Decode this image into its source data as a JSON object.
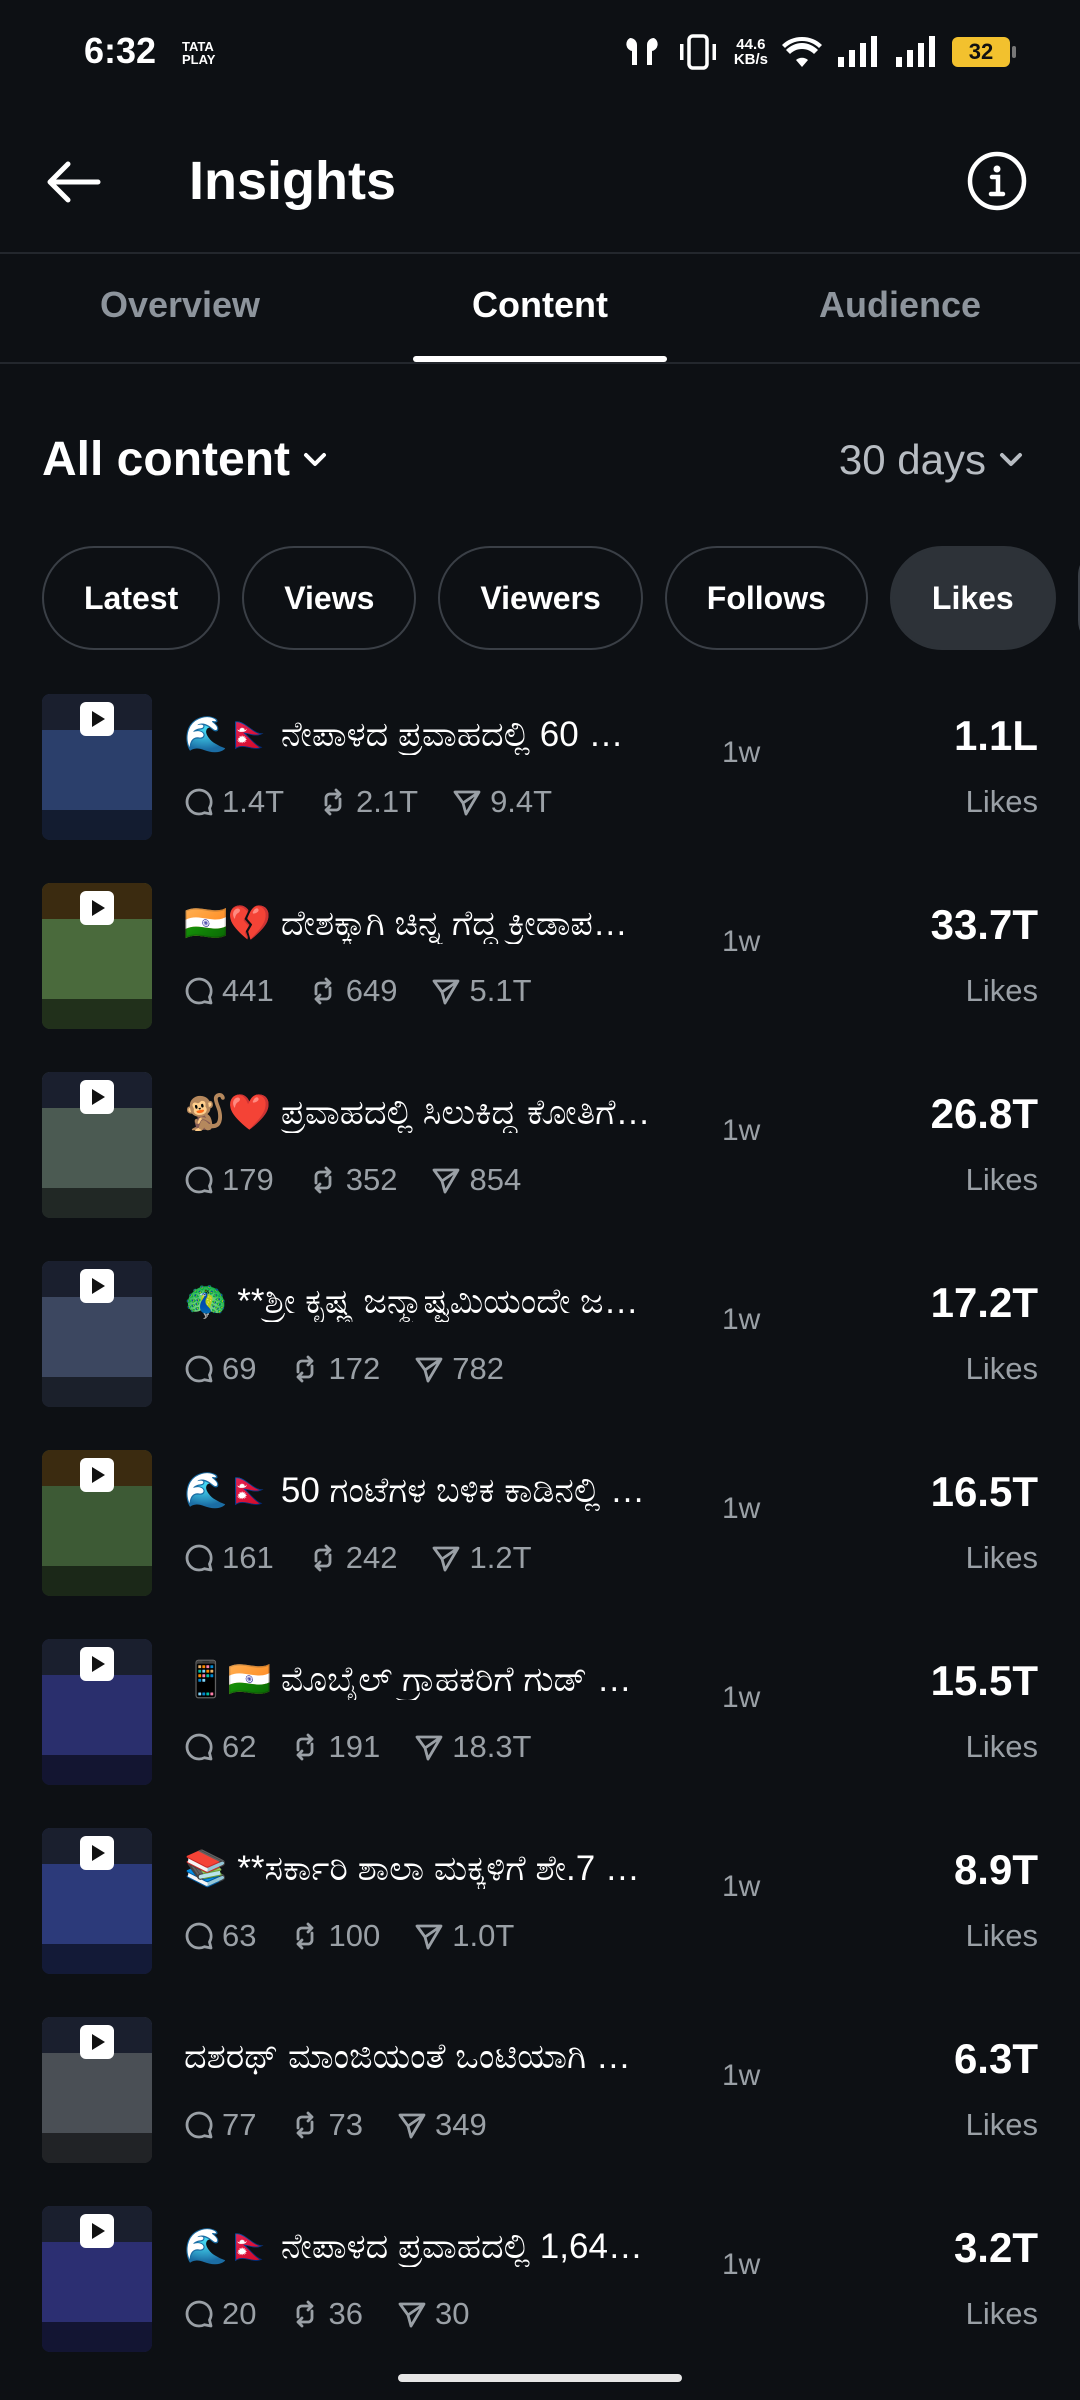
{
  "status": {
    "time": "6:32",
    "carrier": "TATA\nPLAY",
    "speed": "44.6\nKB/s",
    "battery": "32"
  },
  "header": {
    "title": "Insights"
  },
  "tabs": [
    "Overview",
    "Content",
    "Audience"
  ],
  "active_tab": "Content",
  "content_filter": "All content",
  "range": "30 days",
  "chips": [
    "Latest",
    "Views",
    "Viewers",
    "Follows",
    "Likes"
  ],
  "active_chip": "Likes",
  "metric_label": "Likes",
  "posts": [
    {
      "title": "🌊🇳🇵 ನೇಪಾಳದ ಪ್ರವಾಹದಲ್ಲಿ 60 …",
      "age": "1w",
      "replies": "1.4T",
      "reposts": "2.1T",
      "shares": "9.4T",
      "likes": "1.1L",
      "thumb_color": "#2b3f6b"
    },
    {
      "title": "🇮🇳💔 ದೇಶಕ್ಕಾಗಿ ಚಿನ್ನ ಗೆದ್ದ ಕ್ರೀಡಾಪ…",
      "age": "1w",
      "replies": "441",
      "reposts": "649",
      "shares": "5.1T",
      "likes": "33.7T",
      "thumb_color": "#4a6a3c"
    },
    {
      "title": "🐒❤️ ಪ್ರವಾಹದಲ್ಲಿ ಸಿಲುಕಿದ್ದ ಕೋತಿಗೆ…",
      "age": "1w",
      "replies": "179",
      "reposts": "352",
      "shares": "854",
      "likes": "26.8T",
      "thumb_color": "#4b5a52"
    },
    {
      "title": "🦚 **ಶ್ರೀ ಕೃಷ್ಣ ಜನ್ಮಾಷ್ಟಮಿಯಂದೇ ಜ…",
      "age": "1w",
      "replies": "69",
      "reposts": "172",
      "shares": "782",
      "likes": "17.2T",
      "thumb_color": "#3c4760"
    },
    {
      "title": "🌊🇳🇵 50 ಗಂಟೆಗಳ ಬಳಿಕ ಕಾಡಿನಲ್ಲಿ …",
      "age": "1w",
      "replies": "161",
      "reposts": "242",
      "shares": "1.2T",
      "likes": "16.5T",
      "thumb_color": "#3d5a35"
    },
    {
      "title": "📱🇮🇳 ಮೊಬೈಲ್ ಗ್ರಾಹಕರಿಗೆ ಗುಡ್ …",
      "age": "1w",
      "replies": "62",
      "reposts": "191",
      "shares": "18.3T",
      "likes": "15.5T",
      "thumb_color": "#2a2f6d"
    },
    {
      "title": "📚 **ಸರ್ಕಾರಿ ಶಾಲಾ ಮಕ್ಕಳಿಗೆ ಶೇ.7 …",
      "age": "1w",
      "replies": "63",
      "reposts": "100",
      "shares": "1.0T",
      "likes": "8.9T",
      "thumb_color": "#2c3a7a"
    },
    {
      "title": "ದಶರಥ್ ಮಾಂಜಿಯಂತೆ ಒಂಟಿಯಾಗಿ …",
      "age": "1w",
      "replies": "77",
      "reposts": "73",
      "shares": "349",
      "likes": "6.3T",
      "thumb_color": "#4a4f55"
    },
    {
      "title": "🌊🇳🇵 ನೇಪಾಳದ ಪ್ರವಾಹದಲ್ಲಿ 1,64…",
      "age": "1w",
      "replies": "20",
      "reposts": "36",
      "shares": "30",
      "likes": "3.2T",
      "thumb_color": "#2c2f72"
    }
  ]
}
